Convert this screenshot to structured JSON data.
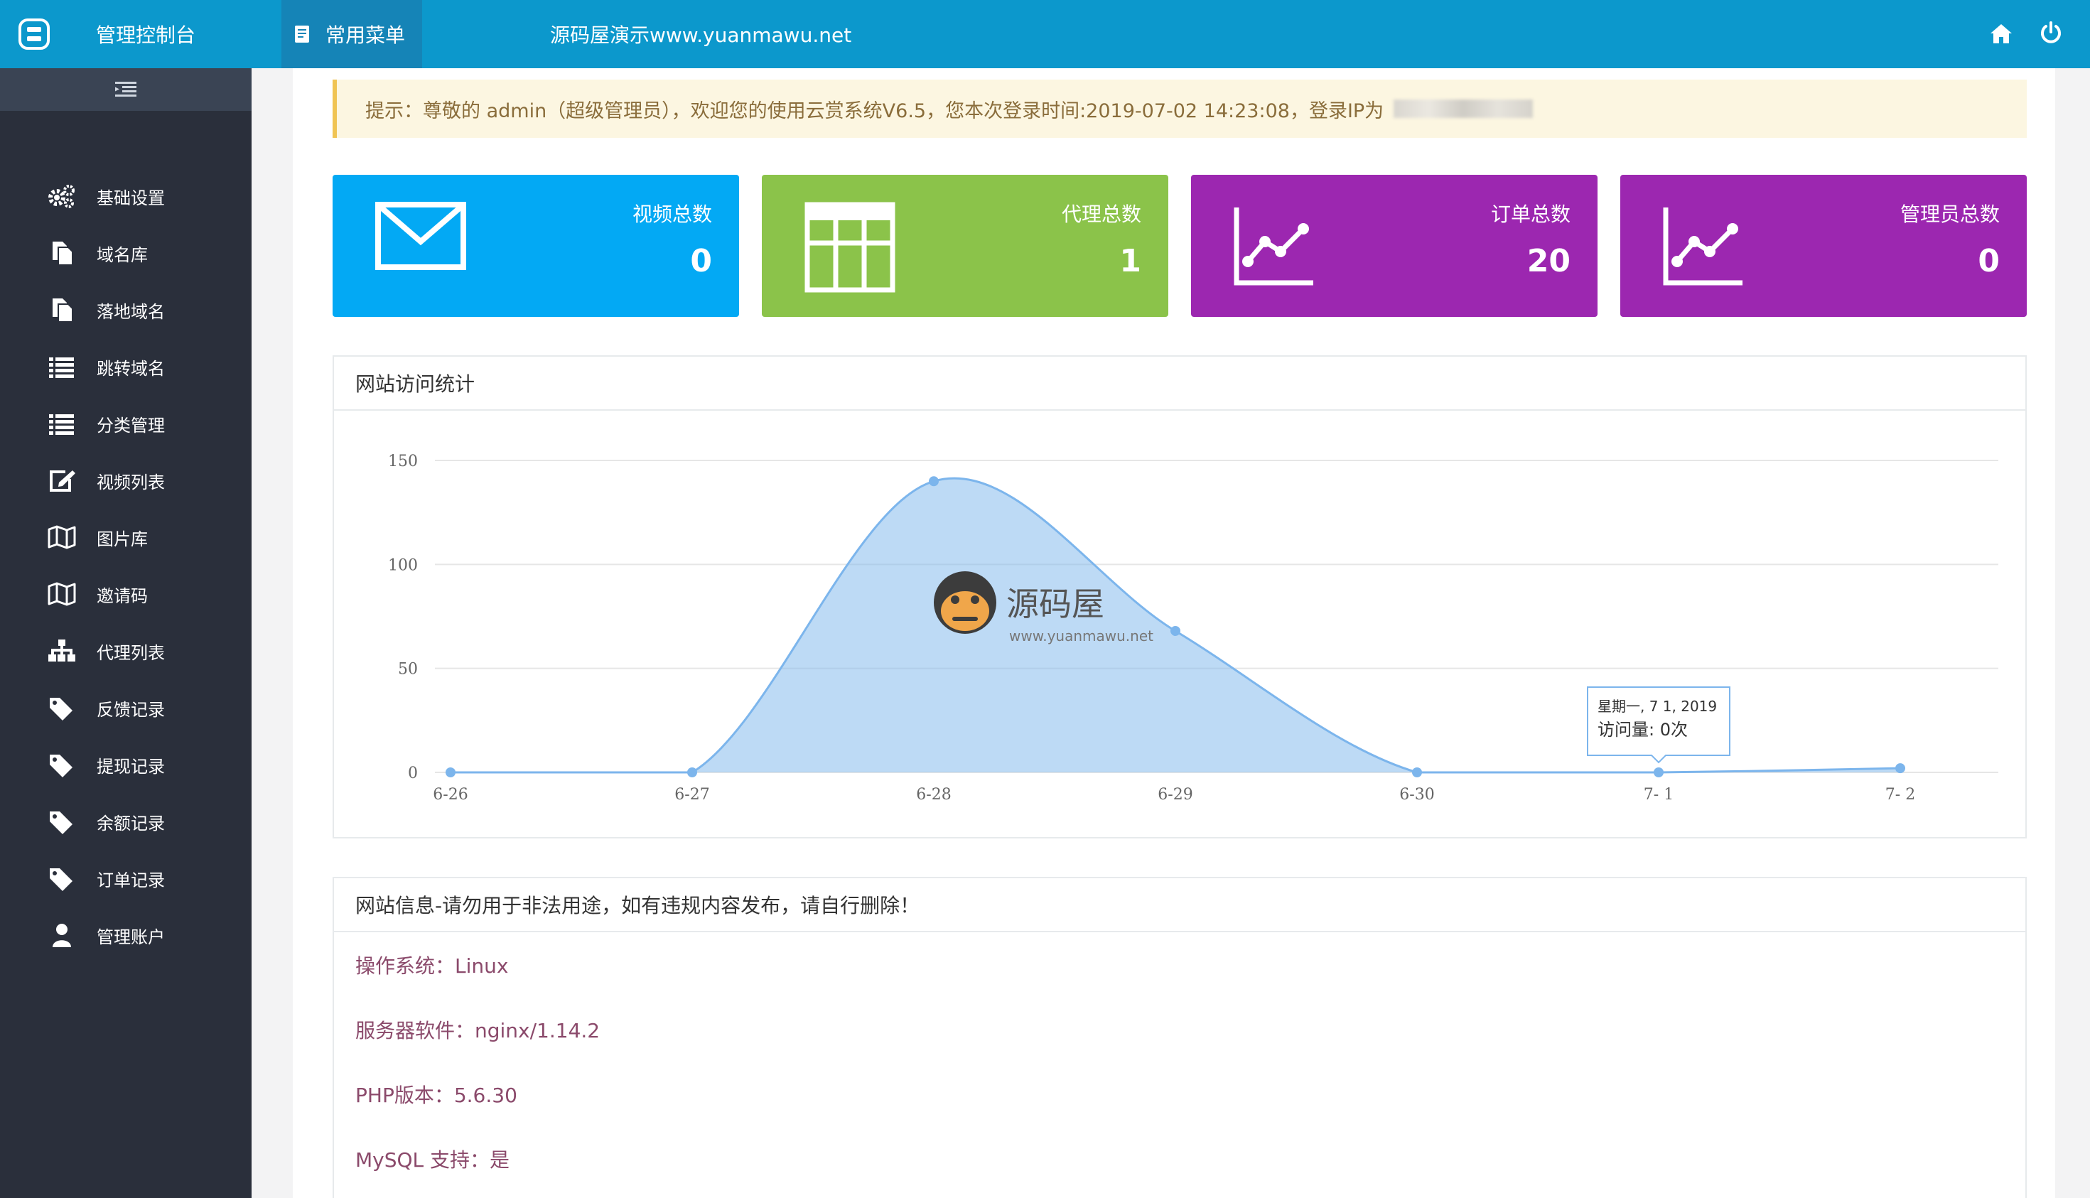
{
  "header": {
    "brand_title": "管理控制台",
    "menu_label": "常用菜单",
    "site_title": "源码屋演示www.yuanmawu.net",
    "colors": {
      "bar": "#0c98cc",
      "menu_active": "#1584b7"
    },
    "icons": {
      "brand": "brand-logo-icon",
      "menu": "document-icon",
      "home": "home-icon",
      "power": "power-icon"
    }
  },
  "sidebar": {
    "items": [
      {
        "label": "基础设置",
        "icon": "gears-icon"
      },
      {
        "label": "域名库",
        "icon": "files-icon"
      },
      {
        "label": "落地域名",
        "icon": "files-icon"
      },
      {
        "label": "跳转域名",
        "icon": "list-icon"
      },
      {
        "label": "分类管理",
        "icon": "list-icon"
      },
      {
        "label": "视频列表",
        "icon": "edit-icon"
      },
      {
        "label": "图片库",
        "icon": "map-icon"
      },
      {
        "label": "邀请码",
        "icon": "map-icon"
      },
      {
        "label": "代理列表",
        "icon": "sitemap-icon"
      },
      {
        "label": "反馈记录",
        "icon": "tag-icon"
      },
      {
        "label": "提现记录",
        "icon": "tag-icon"
      },
      {
        "label": "余额记录",
        "icon": "tag-icon"
      },
      {
        "label": "订单记录",
        "icon": "tag-icon"
      },
      {
        "label": "管理账户",
        "icon": "user-icon"
      }
    ]
  },
  "notice": {
    "text": "提示：尊敬的 admin（超级管理员），欢迎您的使用云赏系统V6.5，您本次登录时间:2019-07-02 14:23:08，登录IP为"
  },
  "cards": [
    {
      "label": "视频总数",
      "value": "0",
      "color": "#03a9f4",
      "icon": "envelope-icon"
    },
    {
      "label": "代理总数",
      "value": "1",
      "color": "#8bc34a",
      "icon": "table-icon"
    },
    {
      "label": "订单总数",
      "value": "20",
      "color": "#9c27b0",
      "icon": "line-chart-icon"
    },
    {
      "label": "管理员总数",
      "value": "0",
      "color": "#9c27b0",
      "icon": "line-chart-icon"
    }
  ],
  "chart_panel": {
    "title": "网站访问统计"
  },
  "chart_data": {
    "type": "area",
    "categories": [
      "6-26",
      "6-27",
      "6-28",
      "6-29",
      "6-30",
      "7- 1",
      "7- 2"
    ],
    "series": [
      {
        "values": [
          0,
          0,
          140,
          68,
          0,
          0,
          2
        ]
      }
    ],
    "y_ticks": [
      "0",
      "50",
      "100",
      "150"
    ],
    "ylim": [
      0,
      150
    ],
    "grid": true,
    "color": "#7cb5ec",
    "tooltip": {
      "date": "星期一, 7 1, 2019",
      "label": "访问量",
      "value": "0次"
    }
  },
  "watermark": {
    "name": "源码屋",
    "url": "www.yuanmawu.net"
  },
  "info_panel": {
    "title": "网站信息-请勿用于非法用途，如有违规内容发布，请自行删除！",
    "rows": [
      "操作系统：Linux",
      "服务器软件：nginx/1.14.2",
      "PHP版本：5.6.30",
      "MySQL 支持：是"
    ]
  }
}
